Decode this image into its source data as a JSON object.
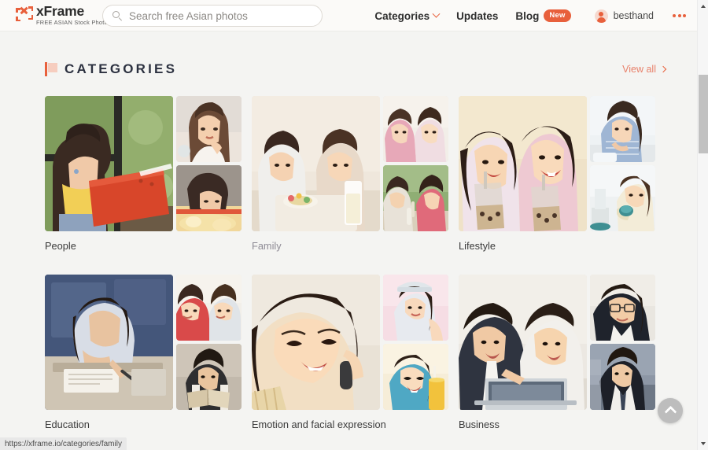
{
  "browser": {
    "status_url": "https://xframe.io/categories/family"
  },
  "header": {
    "logo_name": "xFrame",
    "logo_tagline": "FREE ASIAN Stock Photos",
    "search": {
      "placeholder": "Search free Asian photos",
      "value": "",
      "icon": "search-icon"
    },
    "nav": [
      {
        "label": "Categories",
        "has_dropdown": true
      },
      {
        "label": "Updates",
        "has_dropdown": false
      },
      {
        "label": "Blog",
        "has_dropdown": false,
        "badge": "New"
      }
    ],
    "user": {
      "name": "besthand",
      "avatar_icon": "user-avatar-icon"
    },
    "more_menu_icon": "more-dots-icon"
  },
  "section": {
    "icon": "flag-icon",
    "title": "CATEGORIES",
    "view_all_label": "View all",
    "view_all_icon": "chevron-right-icon"
  },
  "categories": [
    {
      "label": "People",
      "active": false
    },
    {
      "label": "Family",
      "active": true
    },
    {
      "label": "Lifestyle",
      "active": false
    },
    {
      "label": "Education",
      "active": false
    },
    {
      "label": "Emotion and facial expression",
      "active": false
    },
    {
      "label": "Business",
      "active": false
    }
  ],
  "controls": {
    "scroll_to_top_icon": "chevron-up-icon",
    "scrollbar_up_icon": "triangle-up-icon",
    "scrollbar_down_icon": "triangle-down-icon"
  },
  "colors": {
    "accent": "#e8603c",
    "accent_light": "#e8806a",
    "page_bg": "#f4f4f2",
    "header_bg": "#fbfaf8",
    "title_color": "#2c3140",
    "label_color": "#3b3b3b",
    "label_active_color": "#8f8c96"
  }
}
